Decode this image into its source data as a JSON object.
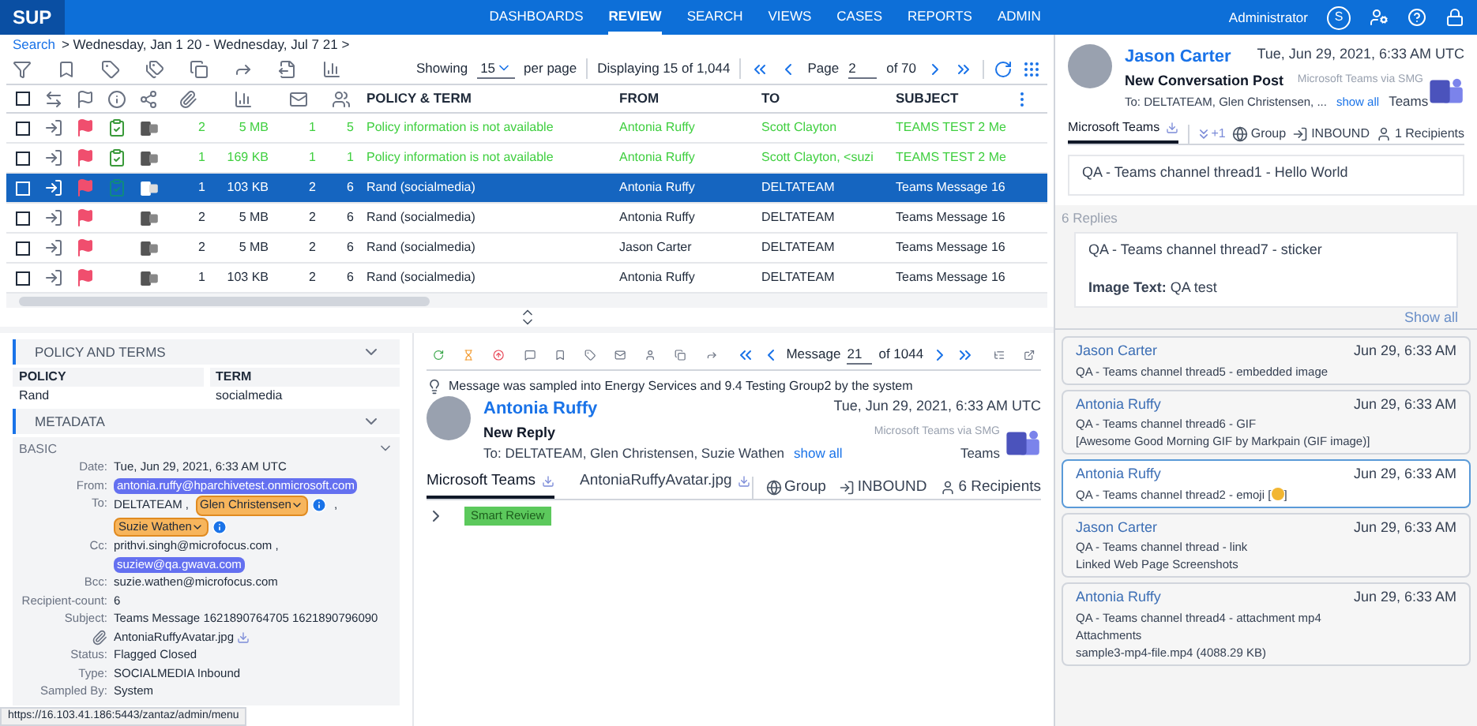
{
  "app": {
    "logo": "SUP",
    "nav": [
      {
        "label": "DASHBOARDS",
        "selected": false
      },
      {
        "label": "REVIEW",
        "selected": true
      },
      {
        "label": "SEARCH",
        "selected": false
      },
      {
        "label": "VIEWS",
        "selected": false
      },
      {
        "label": "CASES",
        "selected": false
      },
      {
        "label": "REPORTS",
        "selected": false
      },
      {
        "label": "ADMIN",
        "selected": false
      }
    ],
    "user": "Administrator",
    "user_initial": "S"
  },
  "breadcrumb": {
    "link": "Search",
    "text": "> Wednesday, Jan 1 20 - Wednesday, Jul 7 21 >"
  },
  "pager": {
    "showing_label": "Showing",
    "per_page": "15",
    "per_page_label": "per page",
    "displaying": "Displaying 15 of 1,044",
    "page_label": "Page",
    "page": "2",
    "of": "of 70"
  },
  "table": {
    "all_checked": false,
    "columns": [
      "",
      "",
      "",
      "",
      "POLICY & TERM",
      "FROM",
      "TO",
      "SUBJECT"
    ],
    "rows": [
      {
        "kind": "no_policy",
        "checked": false,
        "reviewed": true,
        "selected": false,
        "cells": [
          "2",
          "5 MB",
          "1",
          "5",
          "Policy information is not available",
          "Antonia Ruffy",
          "Scott Clayton",
          "TEAMS TEST 2 Me"
        ]
      },
      {
        "kind": "no_policy",
        "checked": false,
        "reviewed": true,
        "selected": false,
        "cells": [
          "1",
          "169 KB",
          "1",
          "1",
          "Policy information is not available",
          "Antonia Ruffy",
          "Scott Clayton, <suzi",
          "TEAMS TEST 2 Me"
        ]
      },
      {
        "kind": "policy",
        "checked": false,
        "reviewed": true,
        "selected": true,
        "cells": [
          "1",
          "103 KB",
          "2",
          "6",
          "Rand (socialmedia)",
          "Antonia Ruffy",
          "DELTATEAM",
          "Teams Message 16"
        ]
      },
      {
        "kind": "policy",
        "checked": false,
        "reviewed": false,
        "selected": false,
        "cells": [
          "2",
          "5 MB",
          "2",
          "6",
          "Rand (socialmedia)",
          "Antonia Ruffy",
          "DELTATEAM",
          "Teams Message 16"
        ]
      },
      {
        "kind": "policy",
        "checked": false,
        "reviewed": false,
        "selected": false,
        "cells": [
          "2",
          "5 MB",
          "2",
          "6",
          "Rand (socialmedia)",
          "Jason Carter",
          "DELTATEAM",
          "Teams Message 16"
        ]
      },
      {
        "kind": "policy",
        "checked": false,
        "reviewed": false,
        "selected": false,
        "cells": [
          "1",
          "103 KB",
          "2",
          "6",
          "Rand (socialmedia)",
          "Antonia Ruffy",
          "DELTATEAM",
          "Teams Message 16"
        ]
      }
    ]
  },
  "policy_panel": {
    "title": "POLICY AND TERMS",
    "columns": [
      "POLICY",
      "TERM"
    ],
    "row": [
      "Rand",
      "socialmedia"
    ]
  },
  "metadata": {
    "title": "METADATA",
    "section": "BASIC",
    "fields": [
      {
        "kind": "labeled",
        "label": "Date:",
        "parts": [
          {
            "kind": "text",
            "text": "Tue, Jun 29, 2021, 6:33 AM UTC"
          }
        ]
      },
      {
        "kind": "labeled",
        "label": "From:",
        "parts": [
          {
            "kind": "email",
            "text": "antonia.ruffy@hparchivetest.onmicrosoft.com"
          }
        ]
      },
      {
        "kind": "labeled",
        "label": "To:",
        "parts": [
          {
            "kind": "text",
            "text": "DELTATEAM ,"
          },
          {
            "kind": "person",
            "text": "Glen Christensen"
          },
          {
            "kind": "text",
            "text": ","
          },
          {
            "kind": "person",
            "text": "Suzie Wathen"
          }
        ]
      },
      {
        "kind": "labeled",
        "label": "Cc:",
        "parts": [
          {
            "kind": "text",
            "text": "prithvi.singh@microfocus.com ,"
          },
          {
            "kind": "email",
            "text": "suziew@qa.gwava.com"
          }
        ]
      },
      {
        "kind": "labeled",
        "label": "Bcc:",
        "parts": [
          {
            "kind": "text",
            "text": "suzie.wathen@microfocus.com"
          }
        ]
      },
      {
        "kind": "labeled",
        "label": "Recipient-count:",
        "parts": [
          {
            "kind": "text",
            "text": "6"
          }
        ]
      },
      {
        "kind": "labeled",
        "label": "Subject:",
        "parts": [
          {
            "kind": "text",
            "text": "Teams Message 1621890764705 1621890796090"
          }
        ]
      },
      {
        "kind": "attachment",
        "parts": [
          {
            "kind": "file",
            "text": "AntoniaRuffyAvatar.jpg"
          }
        ]
      },
      {
        "kind": "labeled",
        "label": "Status:",
        "parts": [
          {
            "kind": "text",
            "text": "Flagged Closed"
          }
        ]
      },
      {
        "kind": "labeled",
        "label": "Type:",
        "parts": [
          {
            "kind": "text",
            "text": "SOCIALMEDIA Inbound"
          }
        ]
      },
      {
        "kind": "labeled",
        "label": "Sampled By:",
        "parts": [
          {
            "kind": "text",
            "text": "System"
          }
        ]
      }
    ]
  },
  "viewer": {
    "message_label": "Message",
    "message_number": "21",
    "message_of": "of 1044",
    "notice": "Message was sampled into Energy Services and 9.4 Testing Group2 by the system",
    "sender": "Antonia Ruffy",
    "date": "Tue, Jun 29, 2021, 6:33 AM UTC",
    "subject": "New Reply",
    "to": "To: DELTATEAM, Glen Christensen, Suzie Wathen",
    "show_all": "show all",
    "source": "Microsoft Teams via SMG",
    "source_app": "Teams",
    "tabs": [
      {
        "label": "Microsoft Teams",
        "selected": true
      },
      {
        "label": "AntoniaRuffyAvatar.jpg",
        "selected": false
      }
    ],
    "meta": [
      "Group",
      "INBOUND",
      "6 Recipients"
    ],
    "tag": "Smart Review"
  },
  "thread": {
    "sender": "Jason Carter",
    "date": "Tue, Jun 29, 2021, 6:33 AM UTC",
    "subject": "New Conversation Post",
    "to": "To: DELTATEAM, Glen Christensen, ...",
    "show_all": "show all",
    "source": "Microsoft Teams via SMG",
    "source_app": "Teams",
    "tabs": [
      {
        "label": "Microsoft Teams",
        "selected": true
      }
    ],
    "more": "+1",
    "meta": [
      "Group",
      "INBOUND",
      "1 Recipients"
    ],
    "body": "QA - Teams channel thread1 - Hello World",
    "replies_label": "6 Replies",
    "open_reply": {
      "text": "QA - Teams channel thread7 - sticker",
      "image_text": "**Image Text:** QA test",
      "show_all": "Show all"
    },
    "cards": [
      {
        "name": "Jason Carter",
        "time": "Jun 29, 6:33 AM",
        "selected": false,
        "lines": [
          "QA - Teams channel thread5 - embedded image"
        ]
      },
      {
        "name": "Antonia Ruffy",
        "time": "Jun 29, 6:33 AM",
        "selected": false,
        "lines": [
          "QA - Teams channel thread6 - GIF",
          "[Awesome Good Morning GIF by Markpain (GIF image)]"
        ]
      },
      {
        "name": "Antonia Ruffy",
        "time": "Jun 29, 6:33 AM",
        "selected": true,
        "lines": [
          "QA - Teams channel thread2 - emoji [",
          "]"
        ],
        "emoji": true
      },
      {
        "name": "Jason Carter",
        "time": "Jun 29, 6:33 AM",
        "selected": false,
        "lines": [
          "QA - Teams channel thread - link",
          "Linked Web Page Screenshots"
        ]
      },
      {
        "name": "Antonia Ruffy",
        "time": "Jun 29, 6:33 AM",
        "selected": false,
        "lines": [
          "QA - Teams channel thread4 - attachment mp4",
          "Attachments",
          "sample3-mp4-file.mp4 (4088.29 KB)"
        ]
      }
    ]
  },
  "status_url": "https://16.103.41.186:5443/zantaz/admin/menu"
}
